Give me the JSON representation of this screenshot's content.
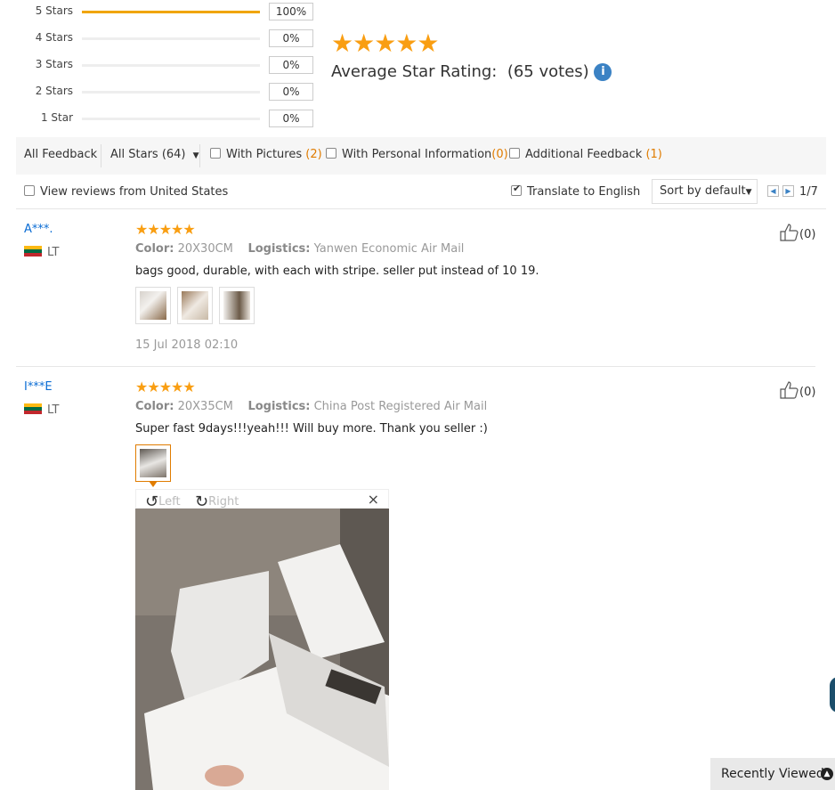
{
  "distribution": [
    {
      "label": "5 Stars",
      "pct": "100%",
      "fill": 1.0
    },
    {
      "label": "4 Stars",
      "pct": "0%",
      "fill": 0
    },
    {
      "label": "3 Stars",
      "pct": "0%",
      "fill": 0
    },
    {
      "label": "2 Stars",
      "pct": "0%",
      "fill": 0
    },
    {
      "label": "1 Star",
      "pct": "0%",
      "fill": 0
    }
  ],
  "summary": {
    "stars": "★★★★★",
    "label": "Average Star Rating:",
    "votes": "(65 votes)",
    "info_glyph": "i"
  },
  "filters": {
    "all_feedback": "All Feedback",
    "all_stars": "All Stars (64)",
    "with_pictures": "With Pictures",
    "with_pictures_count": "(2)",
    "with_personal": "With Personal Information",
    "with_personal_count": "(0)",
    "additional": "Additional Feedback",
    "additional_count": "(1)"
  },
  "subbar": {
    "view_us": "View reviews from United States",
    "translate": "Translate to English",
    "translate_checked": true,
    "sort": "Sort by default",
    "page": "1/7"
  },
  "reviews": [
    {
      "user": "A***.",
      "country": "LT",
      "stars": "★★★★★",
      "color_label": "Color:",
      "color": "20X30CM",
      "logistics_label": "Logistics:",
      "logistics": "Yanwen Economic Air Mail",
      "text": "bags good, durable, with each with stripe. seller put instead of 10 19.",
      "date": "15 Jul 2018 02:10",
      "helpful": "(0)"
    },
    {
      "user": "I***E",
      "country": "LT",
      "stars": "★★★★★",
      "color_label": "Color:",
      "color": "20X35CM",
      "logistics_label": "Logistics:",
      "logistics": "China Post Registered Air Mail",
      "text": "Super fast 9days!!!yeah!!! Will buy more. Thank you seller :)",
      "helpful": "(0)"
    }
  ],
  "preview": {
    "left": "Left",
    "right": "Right",
    "close": "×"
  },
  "recently_viewed": "Recently Viewed",
  "colors": {
    "accent": "#f99e12",
    "link": "#0a6cd4",
    "count": "#e07c00"
  }
}
